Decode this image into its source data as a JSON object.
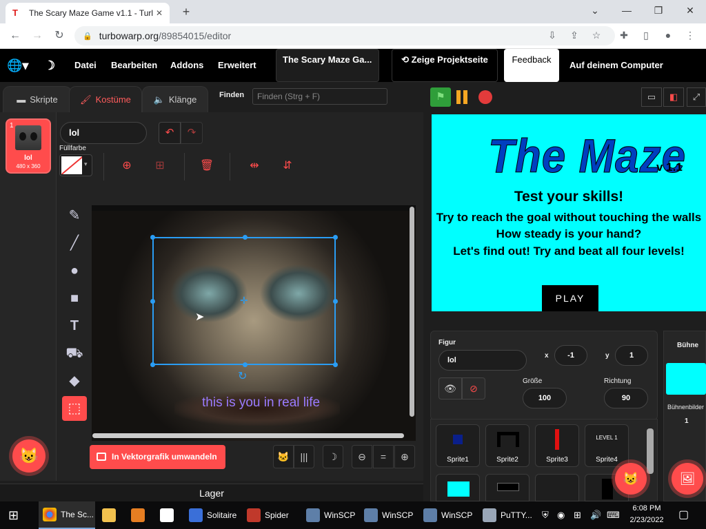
{
  "browser": {
    "tab_title": "The Scary Maze Game v1.1 - Turl",
    "url_host": "turbowarp.org",
    "url_path": "/89854015/editor"
  },
  "menu": {
    "file": "Datei",
    "edit": "Bearbeiten",
    "addons": "Addons",
    "advanced": "Erweitert",
    "project_title": "The Scary Maze Ga...",
    "see_project": "Zeige Projektseite",
    "feedback": "Feedback",
    "save_computer": "Auf deinem Computer speichern"
  },
  "tabs": {
    "code": "Skripte",
    "costumes": "Kostüme",
    "sounds": "Klänge"
  },
  "find": {
    "label": "Finden",
    "placeholder": "Finden (Strg + F)"
  },
  "costume": {
    "index": "1",
    "name": "lol",
    "size": "480 x 360"
  },
  "paint": {
    "name_value": "lol",
    "fill_label": "Füllfarbe",
    "caption": "this is you in real life",
    "convert": "In Vektorgrafik umwandeln",
    "zoom_reset": "="
  },
  "layers": "Lager",
  "stage": {
    "title": "The Maze",
    "version": "v 1.1",
    "line1": "Test your skills!",
    "line2": "Try to reach the goal without touching the walls",
    "line3": "How steady is your hand?",
    "line4": "Let's find out! Try and beat all four levels!",
    "play": "PLAY"
  },
  "sprite_info": {
    "figure_label": "Figur",
    "name": "lol",
    "x_label": "x",
    "x": "-1",
    "y_label": "y",
    "y": "1",
    "size_label": "Größe",
    "size": "100",
    "dir_label": "Richtung",
    "direction": "90"
  },
  "sprites": [
    {
      "name": "Sprite1"
    },
    {
      "name": "Sprite2"
    },
    {
      "name": "Sprite3"
    },
    {
      "name": "Sprite4",
      "thumb_text": "LEVEL 1"
    }
  ],
  "stage_panel": {
    "title": "Bühne",
    "backdrops_label": "Bühnenbilder",
    "backdrops": "1"
  },
  "taskbar": {
    "items": [
      "The Sc...",
      "Solitaire",
      "Spider",
      "WinSCP",
      "WinSCP",
      "WinSCP",
      "PuTTY..."
    ],
    "time": "6:08 PM",
    "date": "2/23/2022"
  },
  "colors": {
    "accent": "#ff4c4c",
    "stage": "#00ffff",
    "flag": "#2f9e3a"
  }
}
